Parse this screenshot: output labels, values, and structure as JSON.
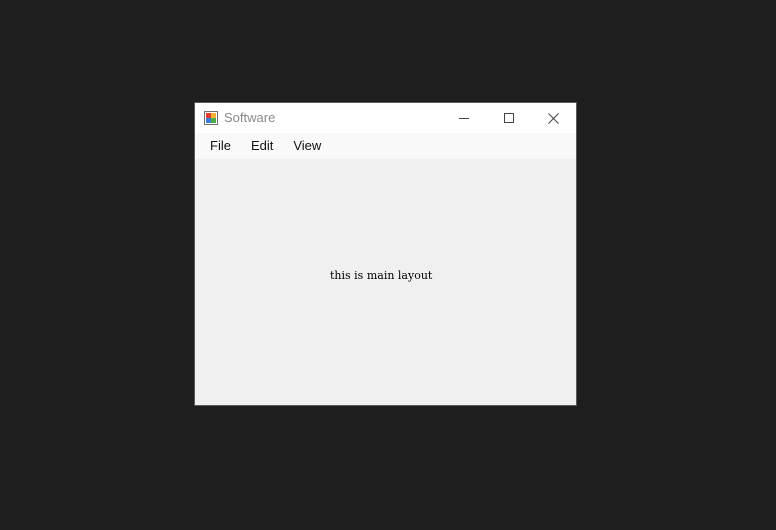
{
  "window": {
    "title": "Software",
    "icon": "app-icon",
    "controls": [
      "minimize-icon",
      "maximize-icon",
      "close-icon"
    ]
  },
  "menu": {
    "items": [
      {
        "label": "File"
      },
      {
        "label": "Edit"
      },
      {
        "label": "View"
      }
    ]
  },
  "main": {
    "text": "this is main layout"
  },
  "colors": {
    "desktop": "#1e1e1e",
    "title_bar": "#ffffff",
    "menu_bar": "#f9f9f9",
    "client": "#f0f0f0",
    "title_text": "#8a8a8a"
  }
}
